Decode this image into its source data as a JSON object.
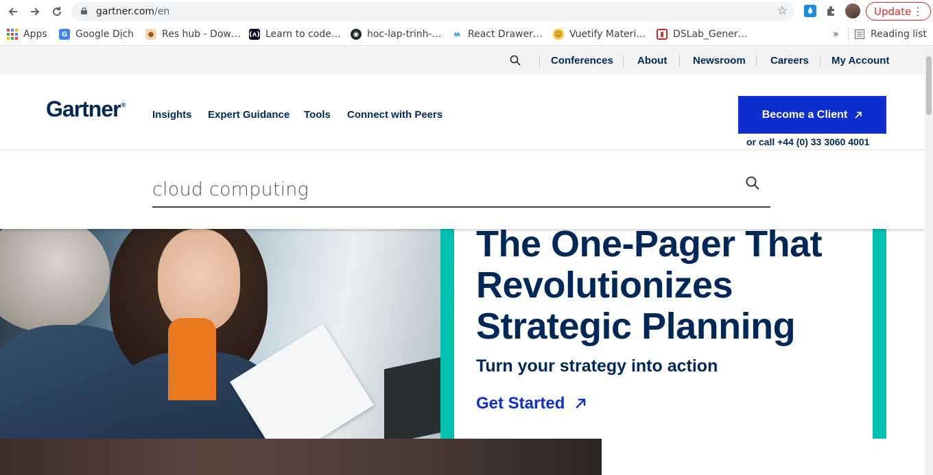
{
  "browser": {
    "url_host": "gartner.com",
    "url_path": "/en",
    "update_label": "Update",
    "bookmarks": [
      {
        "label": "Apps"
      },
      {
        "label": "Google Dịch"
      },
      {
        "label": "Res hub - Dow…"
      },
      {
        "label": "Learn to code…"
      },
      {
        "label": "hoc-lap-trinh-…"
      },
      {
        "label": "React Drawer…"
      },
      {
        "label": "Vuetify Materi…"
      },
      {
        "label": "DSLab_Gener…"
      }
    ],
    "overflow_label": "»",
    "reading_list_label": "Reading list"
  },
  "utility_nav": {
    "links": [
      {
        "label": "Conferences"
      },
      {
        "label": "About"
      },
      {
        "label": "Newsroom"
      },
      {
        "label": "Careers"
      },
      {
        "label": "My Account"
      }
    ]
  },
  "header": {
    "logo": "Gartner",
    "logo_mark": "®",
    "nav": [
      {
        "label": "Insights"
      },
      {
        "label": "Expert Guidance"
      },
      {
        "label": "Tools"
      },
      {
        "label": "Connect with Peers"
      }
    ],
    "cta_label": "Become a Client",
    "phone_text": "or call +44 (0) 33 3060 4001"
  },
  "search": {
    "value": "cloud computing"
  },
  "hero": {
    "title_line1": "The One-Pager That",
    "title_line2": "Revolutionizes",
    "title_line3": "Strategic Planning",
    "subtitle": "Turn your strategy into action",
    "link_label": "Get Started"
  },
  "colors": {
    "brand_navy": "#002856",
    "cta_blue": "#0e2fce",
    "accent_teal": "#00c1b0"
  }
}
